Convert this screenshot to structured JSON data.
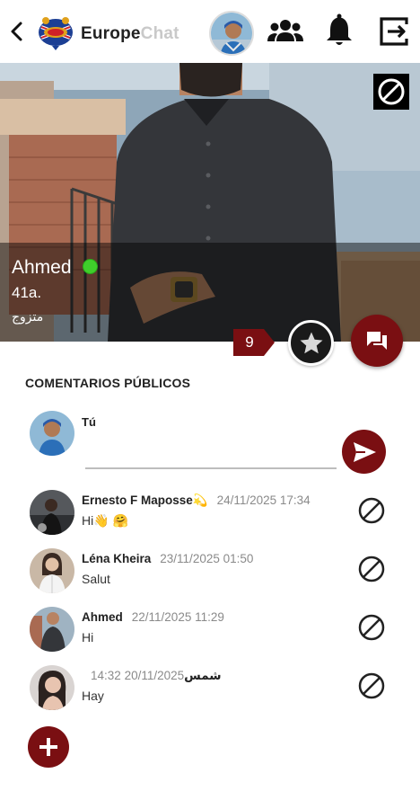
{
  "header": {
    "brand_main": "Europe",
    "brand_sub": "Chat",
    "icons": [
      "back-arrow-icon",
      "groups-icon",
      "bell-icon",
      "logout-icon"
    ]
  },
  "profile": {
    "name": "Ahmed",
    "age": "41a.",
    "status": "متزوج",
    "online": true,
    "count_badge": "9"
  },
  "comments_section": {
    "title": "COMENTARIOS PÚBLICOS",
    "me_label": "Tú",
    "input_value": "",
    "input_placeholder": "",
    "comments": [
      {
        "author": "Ernesto F Maposse💫",
        "date": "24/11/2025 17:34",
        "text": "Hi👋 🤗"
      },
      {
        "author": "Léna Kheira",
        "date": "23/11/2025 01:50",
        "text": "Salut"
      },
      {
        "author": "Ahmed",
        "date": "22/11/2025 11:29",
        "text": "Hi"
      },
      {
        "author": "شمس",
        "date": "20/11/2025 14:32",
        "text": "Hay"
      }
    ]
  },
  "colors": {
    "accent": "#7a0f12",
    "online": "#3fcf2b",
    "muted": "#8a8a8a"
  }
}
